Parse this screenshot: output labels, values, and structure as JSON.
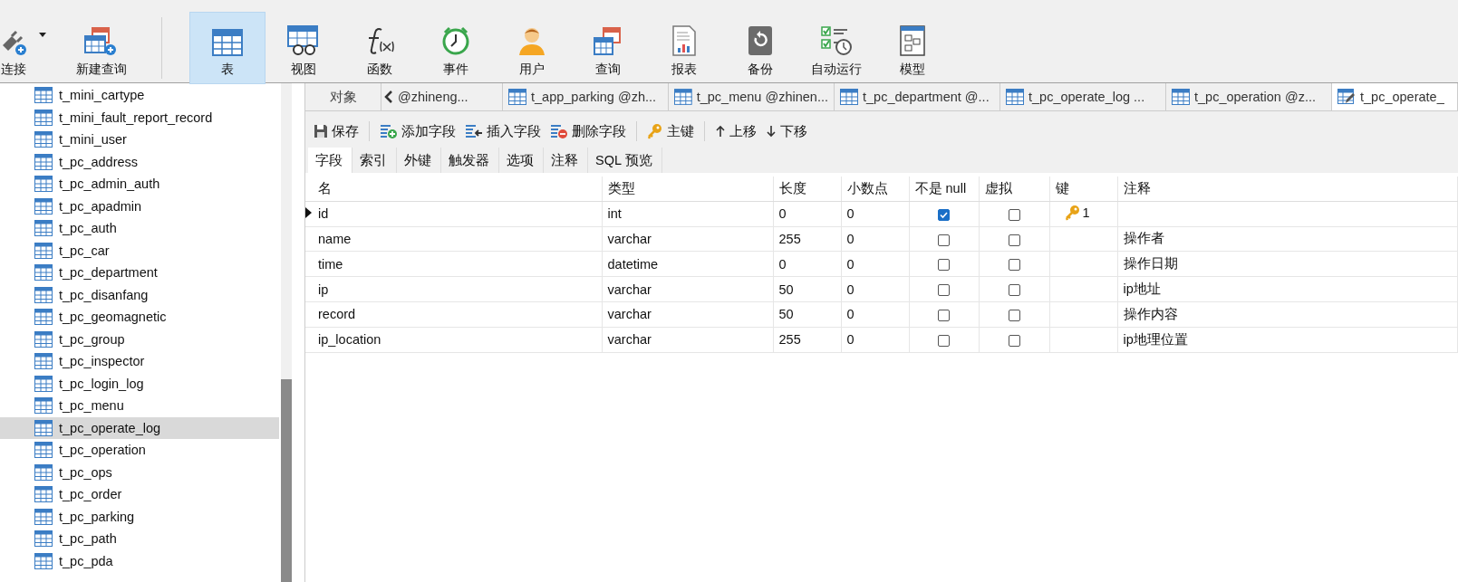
{
  "toolbar": {
    "items": [
      {
        "label": "连接",
        "selected": false
      },
      {
        "label": "新建查询",
        "selected": false
      },
      {
        "label": "表",
        "selected": true
      },
      {
        "label": "视图",
        "selected": false
      },
      {
        "label": "函数",
        "selected": false
      },
      {
        "label": "事件",
        "selected": false
      },
      {
        "label": "用户",
        "selected": false
      },
      {
        "label": "查询",
        "selected": false
      },
      {
        "label": "报表",
        "selected": false
      },
      {
        "label": "备份",
        "selected": false
      },
      {
        "label": "自动运行",
        "selected": false
      },
      {
        "label": "模型",
        "selected": false
      }
    ]
  },
  "sidebar": {
    "items": [
      {
        "label": "t_mini_cartype",
        "selected": false
      },
      {
        "label": "t_mini_fault_report_record",
        "selected": false
      },
      {
        "label": "t_mini_user",
        "selected": false
      },
      {
        "label": "t_pc_address",
        "selected": false
      },
      {
        "label": "t_pc_admin_auth",
        "selected": false
      },
      {
        "label": "t_pc_apadmin",
        "selected": false
      },
      {
        "label": "t_pc_auth",
        "selected": false
      },
      {
        "label": "t_pc_car",
        "selected": false
      },
      {
        "label": "t_pc_department",
        "selected": false
      },
      {
        "label": "t_pc_disanfang",
        "selected": false
      },
      {
        "label": "t_pc_geomagnetic",
        "selected": false
      },
      {
        "label": "t_pc_group",
        "selected": false
      },
      {
        "label": "t_pc_inspector",
        "selected": false
      },
      {
        "label": "t_pc_login_log",
        "selected": false
      },
      {
        "label": "t_pc_menu",
        "selected": false
      },
      {
        "label": "t_pc_operate_log",
        "selected": true
      },
      {
        "label": "t_pc_operation",
        "selected": false
      },
      {
        "label": "t_pc_ops",
        "selected": false
      },
      {
        "label": "t_pc_order",
        "selected": false
      },
      {
        "label": "t_pc_parking",
        "selected": false
      },
      {
        "label": "t_pc_path",
        "selected": false
      },
      {
        "label": "t_pc_pda",
        "selected": false
      }
    ]
  },
  "tabs": [
    {
      "label": "对象",
      "kind": "object",
      "selected": false
    },
    {
      "label": "@zhineng...",
      "kind": "partial",
      "selected": false
    },
    {
      "label": "t_app_parking @zh...",
      "kind": "table",
      "selected": false
    },
    {
      "label": "t_pc_menu @zhinen...",
      "kind": "table",
      "selected": false
    },
    {
      "label": "t_pc_department @...",
      "kind": "table",
      "selected": false
    },
    {
      "label": "t_pc_operate_log ...",
      "kind": "table",
      "selected": false
    },
    {
      "label": "t_pc_operation @z...",
      "kind": "table",
      "selected": false
    },
    {
      "label": "t_pc_operate_",
      "kind": "design",
      "selected": true
    }
  ],
  "actions": [
    {
      "label": "保存"
    },
    {
      "label": "添加字段"
    },
    {
      "label": "插入字段"
    },
    {
      "label": "删除字段"
    },
    {
      "label": "主键"
    },
    {
      "label": "上移"
    },
    {
      "label": "下移"
    }
  ],
  "subtabs": [
    {
      "label": "字段",
      "selected": true
    },
    {
      "label": "索引",
      "selected": false
    },
    {
      "label": "外键",
      "selected": false
    },
    {
      "label": "触发器",
      "selected": false
    },
    {
      "label": "选项",
      "selected": false
    },
    {
      "label": "注释",
      "selected": false
    },
    {
      "label": "SQL 预览",
      "selected": false
    }
  ],
  "table": {
    "columns": [
      "名",
      "类型",
      "长度",
      "小数点",
      "不是 null",
      "虚拟",
      "键",
      "注释"
    ],
    "rows": [
      {
        "name": "id",
        "type": "int",
        "length": "0",
        "decimals": "0",
        "not_null": true,
        "virtual": false,
        "key": "1",
        "current": true
      },
      {
        "name": "name",
        "type": "varchar",
        "length": "255",
        "decimals": "0",
        "not_null": false,
        "virtual": false,
        "comment": "操作者",
        "current": false
      },
      {
        "name": "time",
        "type": "datetime",
        "length": "0",
        "decimals": "0",
        "not_null": false,
        "virtual": false,
        "comment": "操作日期",
        "current": false
      },
      {
        "name": "ip",
        "type": "varchar",
        "length": "50",
        "decimals": "0",
        "not_null": false,
        "virtual": false,
        "comment": "ip地址",
        "current": false
      },
      {
        "name": "record",
        "type": "varchar",
        "length": "50",
        "decimals": "0",
        "not_null": false,
        "virtual": false,
        "comment": "操作内容",
        "current": false
      },
      {
        "name": "ip_location",
        "type": "varchar",
        "length": "255",
        "decimals": "0",
        "not_null": false,
        "virtual": false,
        "comment": "ip地理位置",
        "current": false
      }
    ]
  }
}
